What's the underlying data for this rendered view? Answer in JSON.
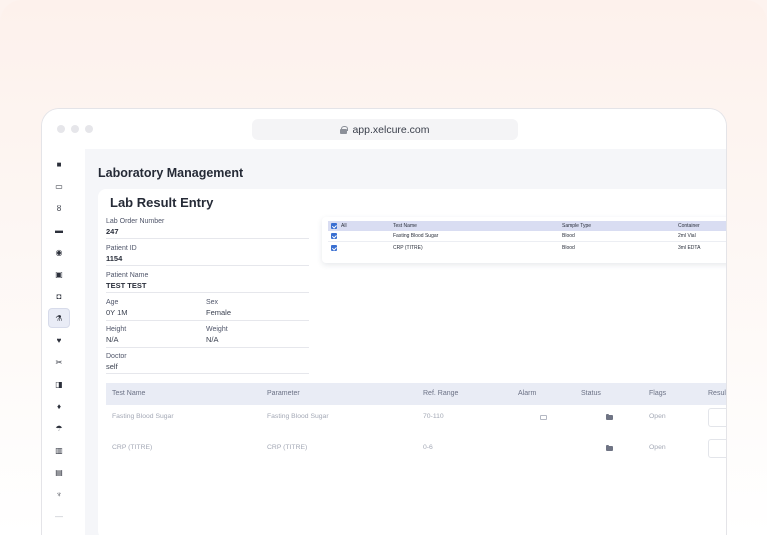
{
  "browser": {
    "url": "app.xelcure.com"
  },
  "header": {
    "title": "Laboratory Management"
  },
  "section": {
    "title": "Lab Result Entry"
  },
  "order": {
    "lab_order_number": {
      "label": "Lab Order Number",
      "value": "247"
    },
    "patient_id": {
      "label": "Patient ID",
      "value": "1154"
    },
    "patient_name": {
      "label": "Patient Name",
      "value": "TEST TEST"
    },
    "age": {
      "label": "Age",
      "value": "0Y 1M"
    },
    "sex": {
      "label": "Sex",
      "value": "Female"
    },
    "height": {
      "label": "Height",
      "value": "N/A"
    },
    "weight": {
      "label": "Weight",
      "value": "N/A"
    },
    "doctor": {
      "label": "Doctor",
      "value": "self"
    }
  },
  "samples": {
    "columns": [
      "All",
      "Test Name",
      "Sample Type",
      "Container"
    ],
    "rows": [
      {
        "test": "Fasting Blood Sugar",
        "sample_type": "Blood",
        "container": "2ml Vial"
      },
      {
        "test": "CRP (TITRE)",
        "sample_type": "Blood",
        "container": "3ml EDTA"
      }
    ]
  },
  "results": {
    "columns": [
      "Test Name",
      "Parameter",
      "Ref. Range",
      "Alarm",
      "Status",
      "Flags",
      "Result"
    ],
    "rows": [
      {
        "test": "Fasting Blood Sugar",
        "parameter": "Fasting Blood Sugar",
        "range": "70-110",
        "flag": "Open"
      },
      {
        "test": "CRP (TITRE)",
        "parameter": "CRP (TITRE)",
        "range": "0-6",
        "flag": "Open"
      }
    ]
  },
  "sidebar": {
    "icons": [
      "dashboard-icon",
      "monitor-icon",
      "stethoscope-icon",
      "bed-icon",
      "eye-icon",
      "id-card-icon",
      "camera-icon",
      "flask-icon",
      "heart-icon",
      "scissors-icon",
      "ambulance-icon",
      "drop-icon",
      "umbrella-icon",
      "building-icon",
      "document-icon",
      "tooth-icon",
      "more-icon"
    ]
  }
}
